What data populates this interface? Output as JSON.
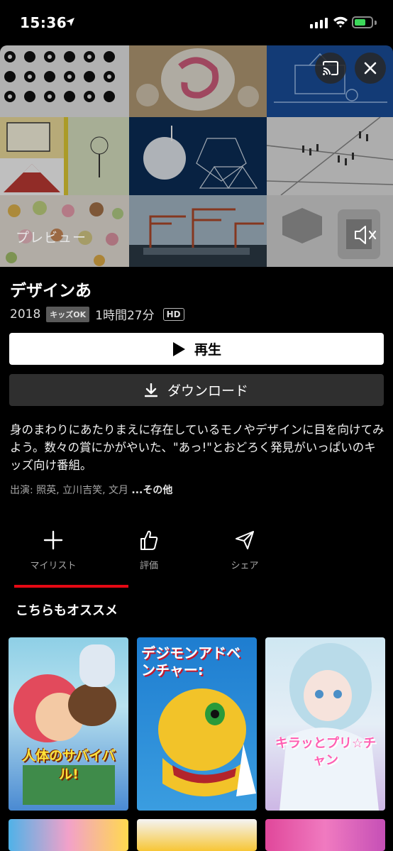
{
  "status": {
    "time": "15:36"
  },
  "preview": {
    "label": "プレビュー"
  },
  "title": "デザインあ",
  "meta": {
    "year": "2018",
    "kids_badge": "キッズOK",
    "duration": "1時間27分",
    "quality": "HD"
  },
  "buttons": {
    "play": "再生",
    "download": "ダウンロード"
  },
  "description": "身のまわりにあたりまえに存在しているモノやデザインに目を向けてみよう。数々の賞にかがやいた、\"あっ!\"とおどろく発見がいっぱいのキッズ向け番組。",
  "cast": {
    "prefix": "出演: 照英, 立川吉笑, 文月 ",
    "more": "...その他"
  },
  "actions": [
    {
      "label": "マイリスト",
      "icon": "plus-icon"
    },
    {
      "label": "評価",
      "icon": "thumbs-up-icon"
    },
    {
      "label": "シェア",
      "icon": "share-icon"
    }
  ],
  "section": {
    "title": "こちらもオススメ"
  },
  "recommendations": [
    {
      "artwork_text": "人体のサバイバル!"
    },
    {
      "artwork_text": "デジモンアドベンチャー:"
    },
    {
      "artwork_text": "キラッとプリ☆チャン"
    }
  ],
  "colors": {
    "accent": "#e50914",
    "background": "#000000",
    "battery": "#3cd85a"
  }
}
